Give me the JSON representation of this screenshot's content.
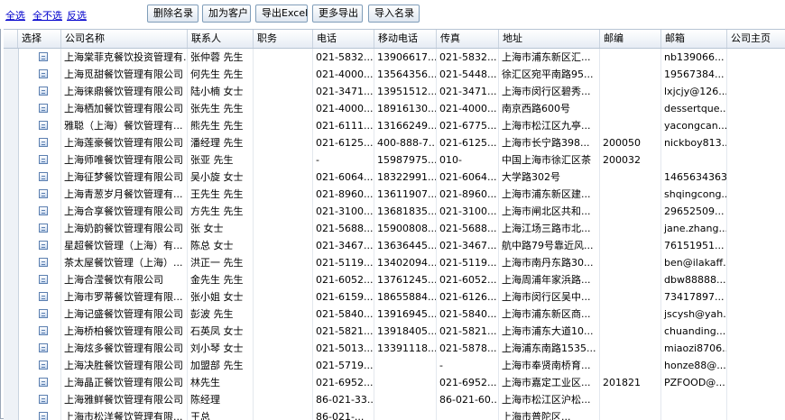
{
  "toolbar": {
    "links": [
      "全选",
      "全不选",
      "反选"
    ],
    "buttons": [
      "删除名录",
      "加为客户",
      "导出Excel",
      "更多导出",
      "导入名录"
    ]
  },
  "grid": {
    "columns": [
      "选择",
      "公司名称",
      "联系人",
      "职务",
      "电话",
      "移动电话",
      "传真",
      "地址",
      "邮编",
      "邮箱",
      "公司主页"
    ],
    "rows": [
      [
        "上海棠菲克餐饮投资管理有...",
        "张仲蓉 先生",
        "",
        "021-5832...",
        "13906617...",
        "021-5832...",
        "上海市浦东新区汇...",
        "",
        "nb139066...",
        ""
      ],
      [
        "上海觅甜餐饮管理有限公司",
        "何先生 先生",
        "",
        "021-4000...",
        "13564356...",
        "021-5448...",
        "徐汇区宛平南路95...",
        "",
        "19567384...",
        ""
      ],
      [
        "上海徕鼎餐饮管理有限公司",
        "陆小楠 女士",
        "",
        "021-3471...",
        "13951512...",
        "021-3471...",
        "上海市闵行区碧秀...",
        "",
        "lxjcjy@126....",
        ""
      ],
      [
        "上海栖加餐饮管理有限公司",
        "张先生 先生",
        "",
        "021-4000...",
        "18916130...",
        "021-4000...",
        "南京西路600号",
        "",
        "dessertque...",
        ""
      ],
      [
        "雅聪（上海）餐饮管理有...",
        "熊先生 先生",
        "",
        "021-6111...",
        "13166249...",
        "021-6775...",
        "上海市松江区九亭...",
        "",
        "yacongcan...",
        ""
      ],
      [
        "上海莲豪餐饮管理有限公司",
        "潘经理 先生",
        "",
        "021-6125...",
        "400-888-7...",
        "021-6125...",
        "上海市长宁路398...",
        "200050",
        "nickboy813...",
        ""
      ],
      [
        "上海师唯餐饮管理有限公司",
        "张亚 先生",
        "",
        "-",
        "15987975...",
        "010-",
        "中国上海市徐汇区茶",
        "200032",
        "",
        ""
      ],
      [
        "上海征梦餐饮管理有限公司",
        "吴小旋 女士",
        "",
        "021-6064...",
        "18322991...",
        "021-6064...",
        "大学路302号",
        "",
        "1465634363",
        ""
      ],
      [
        "上海青葱岁月餐饮管理有...",
        "王先生 先生",
        "",
        "021-8960...",
        "13611907...",
        "021-8960...",
        "上海市浦东新区建...",
        "",
        "shqingcong...",
        ""
      ],
      [
        "上海合享餐饮管理有限公司",
        "方先生 先生",
        "",
        "021-3100...",
        "13681835...",
        "021-3100...",
        "上海市闸北区共和...",
        "",
        "29652509...",
        ""
      ],
      [
        "上海奶韵餐饮管理有限公司",
        "张 女士",
        "",
        "021-5688...",
        "15900808...",
        "021-5688...",
        "上海江场三路市北...",
        "",
        "jane.zhang...",
        ""
      ],
      [
        "星超餐饮管理（上海）有...",
        "陈总 女士",
        "",
        "021-3467...",
        "13636445...",
        "021-3467...",
        "航中路79号靠近风...",
        "",
        "76151951...",
        ""
      ],
      [
        "茶太屋餐饮管理（上海）...",
        "洪正一 先生",
        "",
        "021-5119...",
        "13402094...",
        "021-5119...",
        "上海市南丹东路30...",
        "",
        "ben@ilakaff...",
        ""
      ],
      [
        "上海合滢餐饮有限公司",
        "金先生 先生",
        "",
        "021-6052...",
        "13761245...",
        "021-6052...",
        "上海周浦年家浜路...",
        "",
        "dbw88888...",
        ""
      ],
      [
        "上海市罗蒂餐饮管理有限...",
        "张小姐 女士",
        "",
        "021-6159...",
        "18655884...",
        "021-6126...",
        "上海市闵行区吴中...",
        "",
        "73417897...",
        ""
      ],
      [
        "上海记盛餐饮管理有限公司",
        "彭波 先生",
        "",
        "021-5840...",
        "13916945...",
        "021-5840...",
        "上海市浦东新区商...",
        "",
        "jscysh@yah...",
        ""
      ],
      [
        "上海桥柏餐饮管理有限公司",
        "石英凤 女士",
        "",
        "021-5821...",
        "13918405...",
        "021-5821...",
        "上海市浦东大道10...",
        "",
        "chuanding...",
        ""
      ],
      [
        "上海炫多餐饮管理有限公司",
        "刘小琴 女士",
        "",
        "021-5013...",
        "13391118...",
        "021-5878...",
        "上海浦东南路1535...",
        "",
        "miaozi8706...",
        ""
      ],
      [
        "上海决胜餐饮管理有限公司",
        "加盟部 先生",
        "",
        "021-5719...",
        "",
        "-",
        "上海市奉贤南桥育...",
        "",
        "honze88@...",
        ""
      ],
      [
        "上海晶正餐饮管理有限公司",
        "林先生",
        "",
        "021-6952...",
        "",
        "021-6952...",
        "上海市嘉定工业区...",
        "201821",
        "PZFOOD@...",
        ""
      ],
      [
        "上海雅鲜餐饮管理有限公司",
        "陈经理",
        "",
        "86-021-33...",
        "",
        "86-021-60...",
        "上海市松江区沪松...",
        "",
        "",
        ""
      ],
      [
        "上海市松洋餐饮管理有限...",
        "王总",
        "",
        "86-021-...",
        "",
        "",
        "上海市普陀区...",
        "",
        "",
        ""
      ]
    ]
  }
}
